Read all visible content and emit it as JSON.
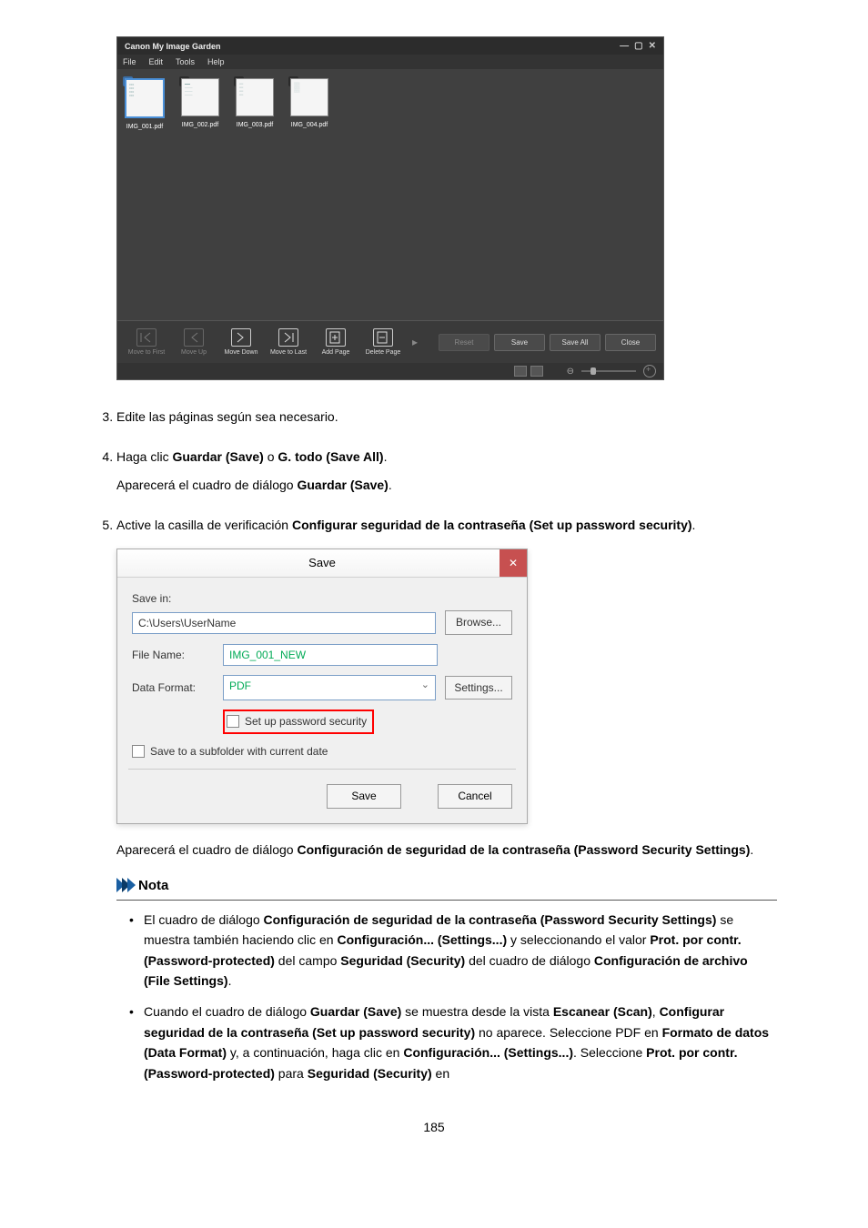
{
  "app": {
    "title": "Canon My Image Garden",
    "menus": [
      "File",
      "Edit",
      "Tools",
      "Help"
    ],
    "thumbs": [
      {
        "num": "1",
        "label": "IMG_001.pdf",
        "selected": true
      },
      {
        "num": "2",
        "label": "IMG_002.pdf",
        "selected": false
      },
      {
        "num": "3",
        "label": "IMG_003.pdf",
        "selected": false
      },
      {
        "num": "4",
        "label": "IMG_004.pdf",
        "selected": false
      }
    ],
    "tools": [
      {
        "label": "Move to First",
        "disabled": true
      },
      {
        "label": "Move Up",
        "disabled": true
      },
      {
        "label": "Move Down",
        "disabled": false
      },
      {
        "label": "Move to Last",
        "disabled": false
      },
      {
        "label": "Add Page",
        "disabled": false
      },
      {
        "label": "Delete Page",
        "disabled": false
      }
    ],
    "buttons": {
      "reset": "Reset",
      "save": "Save",
      "saveAll": "Save All",
      "close": "Close"
    }
  },
  "steps": {
    "s3": "Edite las páginas según sea necesario.",
    "s4_a": "Haga clic ",
    "s4_b": "Guardar (Save)",
    "s4_c": " o ",
    "s4_d": "G. todo (Save All)",
    "s4_e": ".",
    "s4_sub_a": "Aparecerá el cuadro de diálogo ",
    "s4_sub_b": "Guardar (Save)",
    "s4_sub_c": ".",
    "s5_a": "Active la casilla de verificación ",
    "s5_b": "Configurar seguridad de la contraseña (Set up password security)",
    "s5_c": ".",
    "s5_after_a": "Aparecerá el cuadro de diálogo ",
    "s5_after_b": "Configuración de seguridad de la contraseña (Password Security Settings)",
    "s5_after_c": "."
  },
  "saveDialog": {
    "title": "Save",
    "saveIn": "Save in:",
    "path": "C:\\Users\\UserName",
    "browse": "Browse...",
    "fileNameLabel": "File Name:",
    "fileName": "IMG_001_NEW",
    "dataFormatLabel": "Data Format:",
    "dataFormat": "PDF",
    "settings": "Settings...",
    "setupSecurity": "Set up password security",
    "subfolder": "Save to a subfolder with current date",
    "save": "Save",
    "cancel": "Cancel"
  },
  "nota": {
    "title": "Nota",
    "item1": {
      "a": "El cuadro de diálogo ",
      "b": "Configuración de seguridad de la contraseña (Password Security Settings)",
      "c": " se muestra también haciendo clic en ",
      "d": "Configuración... (Settings...)",
      "e": " y seleccionando el valor ",
      "f": "Prot. por contr. (Password-protected)",
      "g": " del campo ",
      "h": "Seguridad (Security)",
      "i": " del cuadro de diálogo ",
      "j": "Configuración de archivo (File Settings)",
      "k": "."
    },
    "item2": {
      "a": "Cuando el cuadro de diálogo ",
      "b": "Guardar (Save)",
      "c": " se muestra desde la vista ",
      "d": "Escanear (Scan)",
      "e": ", ",
      "f": "Configurar seguridad de la contraseña (Set up password security)",
      "g": " no aparece. Seleccione PDF en ",
      "h": "Formato de datos (Data Format)",
      "i": " y, a continuación, haga clic en ",
      "j": "Configuración... (Settings...)",
      "k": ". Seleccione ",
      "l": "Prot. por contr. (Password-protected)",
      "m": " para ",
      "n": "Seguridad (Security)",
      "o": " en"
    }
  },
  "pageNumber": "185"
}
